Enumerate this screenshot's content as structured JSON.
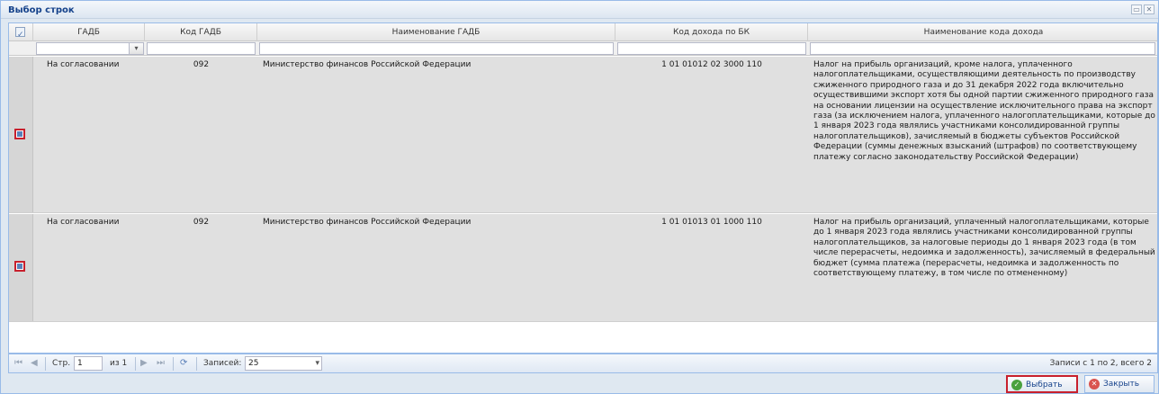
{
  "window": {
    "title": "Выбор строк",
    "min_glyph": "▭",
    "close_glyph": "✕"
  },
  "columns": {
    "gadb": "ГАДБ",
    "kod_gadb": "Код ГАДБ",
    "name_gadb": "Наименование ГАДБ",
    "kod_dohoda": "Код дохода по БК",
    "name_kod": "Наименование кода дохода"
  },
  "filter": {
    "combo_glyph": "▾"
  },
  "rows": [
    {
      "checked": true,
      "gadb": "На согласовании",
      "kod_gadb": "092",
      "name_gadb": "Министерство финансов Российской Федерации",
      "kod_dohoda": "1 01 01012 02 3000 110",
      "name_kod": "Налог на прибыль организаций, кроме налога, уплаченного налогоплательщиками, осуществляющими деятельность по производству сжиженного природного газа и до 31 декабря 2022 года включительно осуществившими экспорт хотя бы одной партии сжиженного природного газа на основании лицензии на осуществление исключительного права на экспорт газа (за исключением налога, уплаченного налогоплательщиками, которые до 1 января 2023 года являлись участниками консолидированной группы налогоплательщиков), зачисляемый в бюджеты субъектов Российской Федерации (суммы денежных взысканий (штрафов) по соответствующему платежу согласно законодательству Российской Федерации)"
    },
    {
      "checked": true,
      "gadb": "На согласовании",
      "kod_gadb": "092",
      "name_gadb": "Министерство финансов Российской Федерации",
      "kod_dohoda": "1 01 01013 01 1000 110",
      "name_kod": "Налог на прибыль организаций, уплаченный налогоплательщиками, которые до 1 января 2023 года являлись участниками консолидированной группы налогоплательщиков, за налоговые периоды до 1 января 2023 года (в том числе перерасчеты, недоимка и задолженность), зачисляемый в федеральный бюджет (сумма платежа (перерасчеты, недоимка и задолженность по соответствующему платежу, в том числе по отмененному)"
    }
  ],
  "pager": {
    "first_icon": "⏮",
    "prev_icon": "◀",
    "page_label": "Стр.",
    "page_value": "1",
    "of_label": "из 1",
    "next_icon": "▶",
    "last_icon": "⏭",
    "refresh_icon": "⟳",
    "records_label": "Записей:",
    "records_value": "25",
    "combo_glyph": "▾",
    "summary": "Записи с 1 по 2, всего 2"
  },
  "buttons": {
    "select": "Выбрать",
    "close": "Закрыть",
    "ok_glyph": "✓",
    "close_glyph": "✕"
  },
  "colors": {
    "highlight": "#c8202d",
    "accent": "#15428b"
  }
}
